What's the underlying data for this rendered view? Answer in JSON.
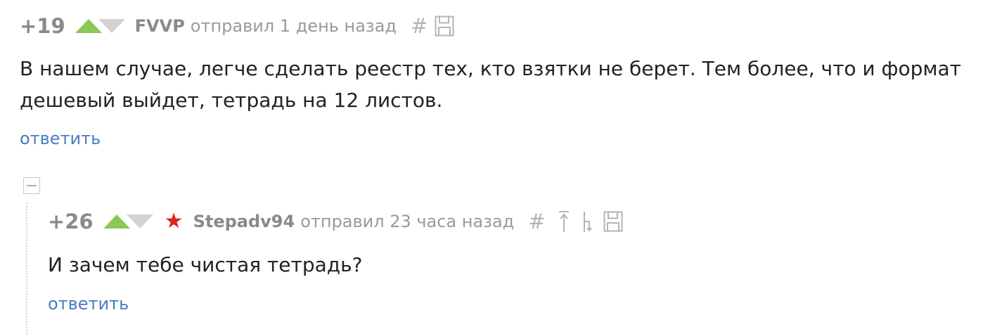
{
  "comments": [
    {
      "rating": "+19",
      "author": "FVVP",
      "meta": "отправил 1 день назад",
      "hash": "#",
      "text_lines": [
        "В нашем случае, легче сделать реестр тех, кто взятки не берет. Тем более, что и формат",
        "дешевый выйдет, тетрадь на 12 листов."
      ],
      "reply_label": "ответить"
    },
    {
      "rating": "+26",
      "author": "Stepadv94",
      "meta": "отправил 23 часа назад",
      "hash": "#",
      "text_lines": [
        "И зачем тебе чистая тетрадь?"
      ],
      "reply_label": "ответить"
    }
  ],
  "colors": {
    "vote_up": "#8ac858",
    "vote_down": "#d2d2d2",
    "star": "#e02020",
    "link": "#4a7cbd"
  },
  "icons": [
    "vote-up-icon",
    "vote-down-icon",
    "star-icon",
    "save-icon",
    "parent-arrow-icon",
    "branch-arrow-icon",
    "collapse-icon"
  ]
}
